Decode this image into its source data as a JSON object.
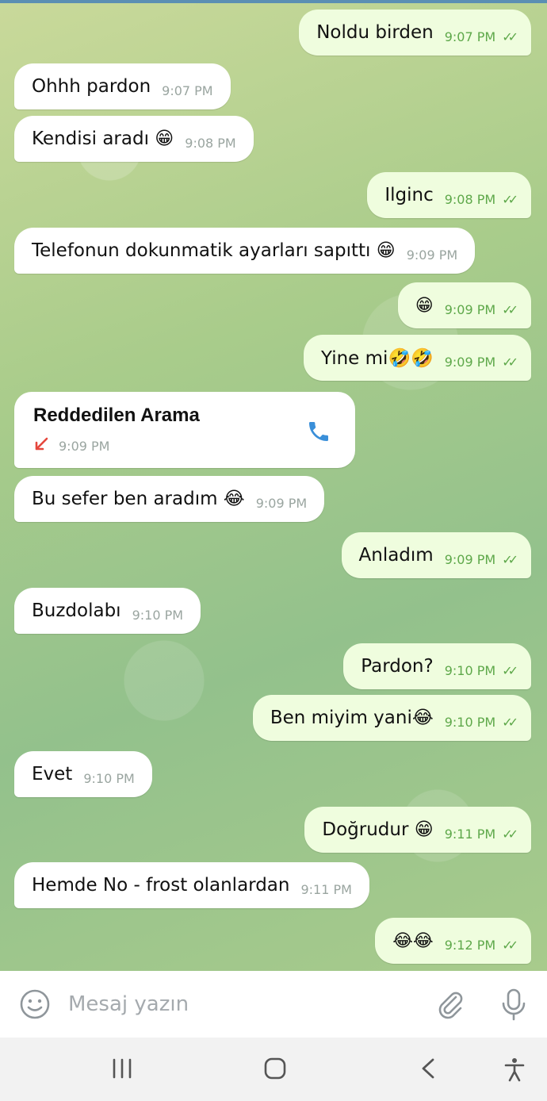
{
  "messages": [
    {
      "dir": "out",
      "text": "Noldu birden",
      "time": "9:07 PM"
    },
    {
      "dir": "in",
      "text": "Ohhh pardon",
      "time": "9:07 PM"
    },
    {
      "dir": "in",
      "text": "Kendisi aradı 😁",
      "time": "9:08 PM"
    },
    {
      "dir": "out",
      "text": "Ilginc",
      "time": "9:08 PM"
    },
    {
      "dir": "in",
      "text": "Telefonun dokunmatik ayarları sapıttı 😁",
      "time": "9:09 PM"
    },
    {
      "dir": "out",
      "text": "😁",
      "time": "9:09 PM"
    },
    {
      "dir": "out",
      "text": "Yine mi🤣🤣",
      "time": "9:09 PM"
    },
    {
      "dir": "in",
      "text": "Bu sefer ben aradım 😂",
      "time": "9:09 PM"
    },
    {
      "dir": "out",
      "text": "Anladım",
      "time": "9:09 PM"
    },
    {
      "dir": "in",
      "text": "Buzdolabı",
      "time": "9:10 PM"
    },
    {
      "dir": "out",
      "text": "Pardon?",
      "time": "9:10 PM"
    },
    {
      "dir": "out",
      "text": "Ben miyim yani😂",
      "time": "9:10 PM"
    },
    {
      "dir": "in",
      "text": "Evet",
      "time": "9:10 PM"
    },
    {
      "dir": "out",
      "text": "Doğrudur 😁",
      "time": "9:11 PM"
    },
    {
      "dir": "in",
      "text": "Hemde No - frost olanlardan",
      "time": "9:11 PM"
    },
    {
      "dir": "out",
      "text": "😂😂",
      "time": "9:12 PM"
    }
  ],
  "call": {
    "title": "Reddedilen Arama",
    "time": "9:09 PM",
    "arrow_icon": "missed-call-arrow",
    "phone_icon": "phone-icon"
  },
  "input": {
    "placeholder": "Mesaj yazın"
  },
  "colors": {
    "incoming": "#ffffff",
    "outgoing": "#effdde",
    "tick": "#5ea84a",
    "phone": "#3a8fd9"
  }
}
